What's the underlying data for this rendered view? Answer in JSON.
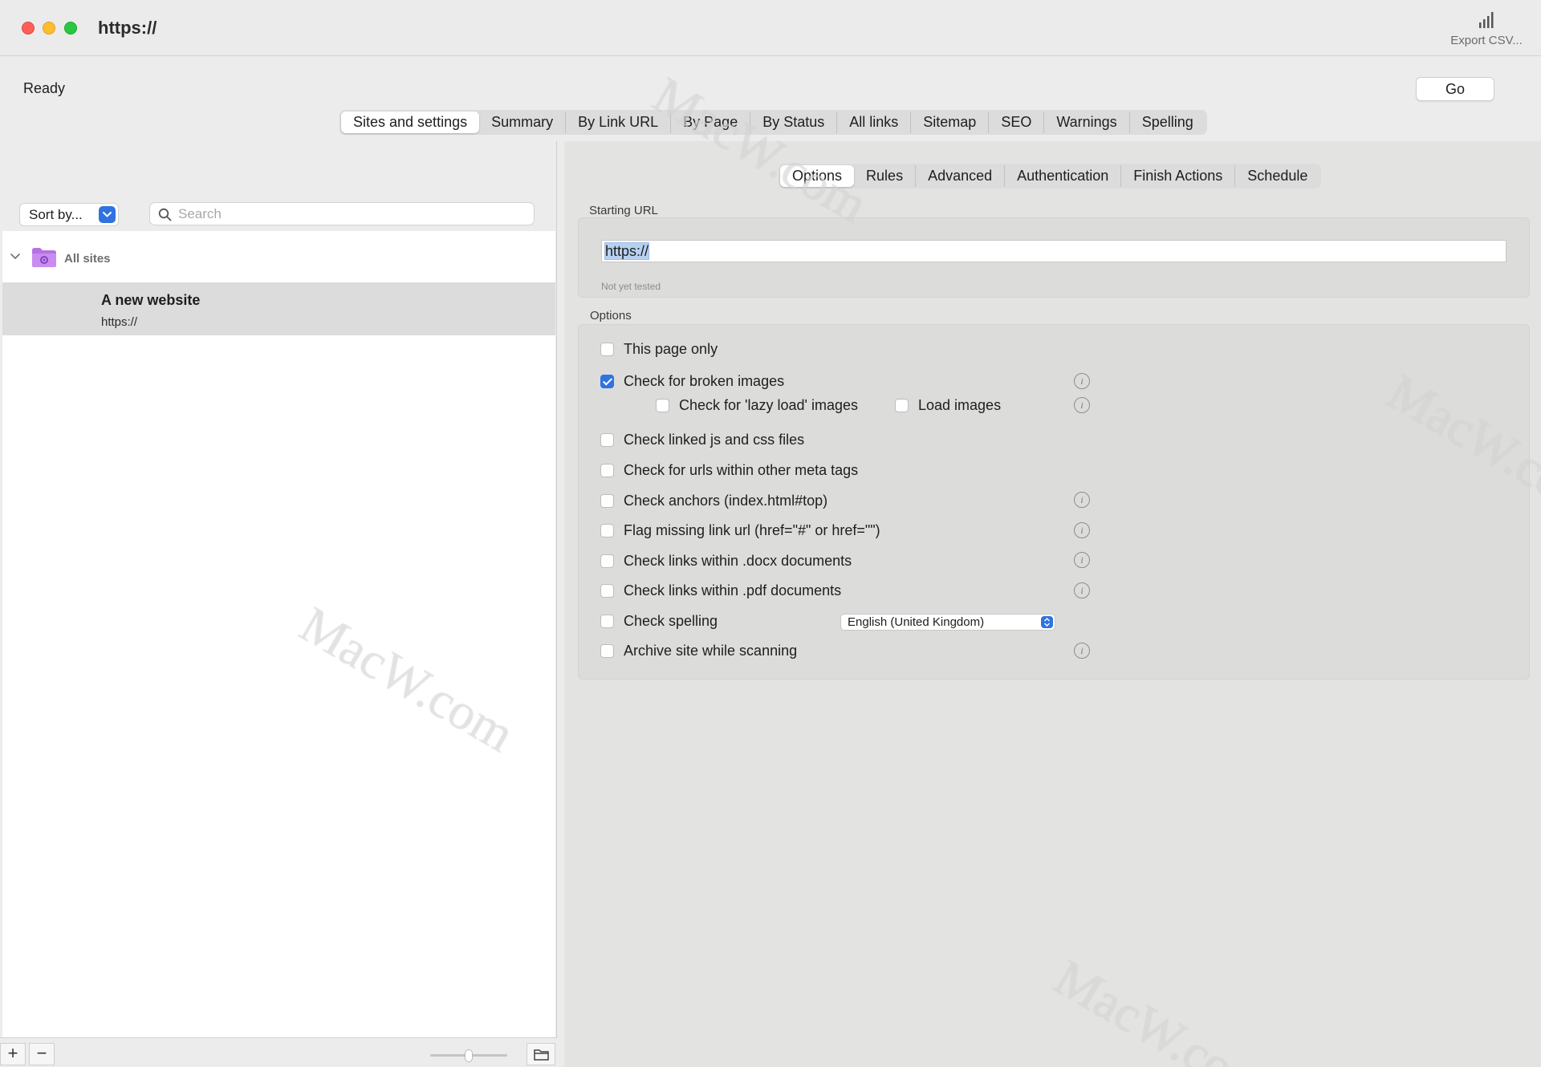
{
  "window": {
    "title": "https://",
    "export_label": "Export CSV..."
  },
  "toolbar": {
    "status": "Ready",
    "go_label": "Go"
  },
  "main_tabs": [
    "Sites and settings",
    "Summary",
    "By Link URL",
    "By Page",
    "By Status",
    "All links",
    "Sitemap",
    "SEO",
    "Warnings",
    "Spelling"
  ],
  "sub_tabs": [
    "Options",
    "Rules",
    "Advanced",
    "Authentication",
    "Finish Actions",
    "Schedule"
  ],
  "sidebar": {
    "sort_label": "Sort by...",
    "search_placeholder": "Search",
    "group_label": "All sites",
    "site": {
      "name": "A new website",
      "url": "https://"
    }
  },
  "settings": {
    "starting_url_label": "Starting URL",
    "starting_url_value": "https://",
    "url_status": "Not yet tested",
    "options_label": "Options",
    "options": [
      {
        "label": "This page only",
        "checked": false
      },
      {
        "label": "Check for broken images",
        "checked": true
      },
      {
        "label": "Check for 'lazy load' images",
        "checked": false
      },
      {
        "label": "Load images",
        "checked": false
      },
      {
        "label": "Check linked js and css files",
        "checked": false
      },
      {
        "label": "Check for urls within other meta tags",
        "checked": false
      },
      {
        "label": "Check anchors (index.html#top)",
        "checked": false
      },
      {
        "label": "Flag missing link url (href=\"#\" or href=\"\")",
        "checked": false
      },
      {
        "label": "Check links within .docx documents",
        "checked": false
      },
      {
        "label": "Check links within .pdf documents",
        "checked": false
      },
      {
        "label": "Check spelling",
        "checked": false
      },
      {
        "label": "Archive site while scanning",
        "checked": false
      }
    ],
    "spelling_language": "English (United Kingdom)"
  },
  "watermark": "MacW.com",
  "colors": {
    "accent": "#2f73e0",
    "selected_row": "#dcdcdc"
  }
}
